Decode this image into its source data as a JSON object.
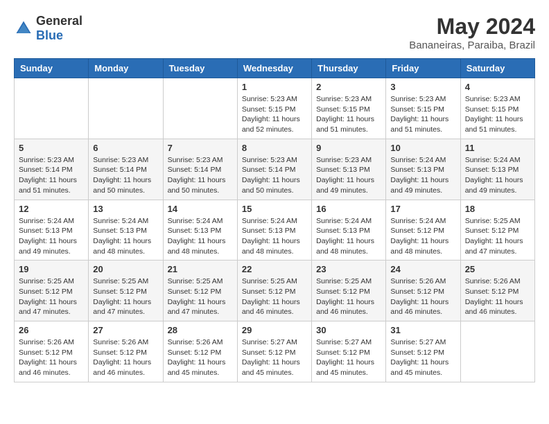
{
  "logo": {
    "general": "General",
    "blue": "Blue"
  },
  "title": {
    "month_year": "May 2024",
    "location": "Bananeiras, Paraiba, Brazil"
  },
  "weekdays": [
    "Sunday",
    "Monday",
    "Tuesday",
    "Wednesday",
    "Thursday",
    "Friday",
    "Saturday"
  ],
  "weeks": [
    [
      {
        "day": "",
        "info": ""
      },
      {
        "day": "",
        "info": ""
      },
      {
        "day": "",
        "info": ""
      },
      {
        "day": "1",
        "info": "Sunrise: 5:23 AM\nSunset: 5:15 PM\nDaylight: 11 hours\nand 52 minutes."
      },
      {
        "day": "2",
        "info": "Sunrise: 5:23 AM\nSunset: 5:15 PM\nDaylight: 11 hours\nand 51 minutes."
      },
      {
        "day": "3",
        "info": "Sunrise: 5:23 AM\nSunset: 5:15 PM\nDaylight: 11 hours\nand 51 minutes."
      },
      {
        "day": "4",
        "info": "Sunrise: 5:23 AM\nSunset: 5:15 PM\nDaylight: 11 hours\nand 51 minutes."
      }
    ],
    [
      {
        "day": "5",
        "info": "Sunrise: 5:23 AM\nSunset: 5:14 PM\nDaylight: 11 hours\nand 51 minutes."
      },
      {
        "day": "6",
        "info": "Sunrise: 5:23 AM\nSunset: 5:14 PM\nDaylight: 11 hours\nand 50 minutes."
      },
      {
        "day": "7",
        "info": "Sunrise: 5:23 AM\nSunset: 5:14 PM\nDaylight: 11 hours\nand 50 minutes."
      },
      {
        "day": "8",
        "info": "Sunrise: 5:23 AM\nSunset: 5:14 PM\nDaylight: 11 hours\nand 50 minutes."
      },
      {
        "day": "9",
        "info": "Sunrise: 5:23 AM\nSunset: 5:13 PM\nDaylight: 11 hours\nand 49 minutes."
      },
      {
        "day": "10",
        "info": "Sunrise: 5:24 AM\nSunset: 5:13 PM\nDaylight: 11 hours\nand 49 minutes."
      },
      {
        "day": "11",
        "info": "Sunrise: 5:24 AM\nSunset: 5:13 PM\nDaylight: 11 hours\nand 49 minutes."
      }
    ],
    [
      {
        "day": "12",
        "info": "Sunrise: 5:24 AM\nSunset: 5:13 PM\nDaylight: 11 hours\nand 49 minutes."
      },
      {
        "day": "13",
        "info": "Sunrise: 5:24 AM\nSunset: 5:13 PM\nDaylight: 11 hours\nand 48 minutes."
      },
      {
        "day": "14",
        "info": "Sunrise: 5:24 AM\nSunset: 5:13 PM\nDaylight: 11 hours\nand 48 minutes."
      },
      {
        "day": "15",
        "info": "Sunrise: 5:24 AM\nSunset: 5:13 PM\nDaylight: 11 hours\nand 48 minutes."
      },
      {
        "day": "16",
        "info": "Sunrise: 5:24 AM\nSunset: 5:13 PM\nDaylight: 11 hours\nand 48 minutes."
      },
      {
        "day": "17",
        "info": "Sunrise: 5:24 AM\nSunset: 5:12 PM\nDaylight: 11 hours\nand 48 minutes."
      },
      {
        "day": "18",
        "info": "Sunrise: 5:25 AM\nSunset: 5:12 PM\nDaylight: 11 hours\nand 47 minutes."
      }
    ],
    [
      {
        "day": "19",
        "info": "Sunrise: 5:25 AM\nSunset: 5:12 PM\nDaylight: 11 hours\nand 47 minutes."
      },
      {
        "day": "20",
        "info": "Sunrise: 5:25 AM\nSunset: 5:12 PM\nDaylight: 11 hours\nand 47 minutes."
      },
      {
        "day": "21",
        "info": "Sunrise: 5:25 AM\nSunset: 5:12 PM\nDaylight: 11 hours\nand 47 minutes."
      },
      {
        "day": "22",
        "info": "Sunrise: 5:25 AM\nSunset: 5:12 PM\nDaylight: 11 hours\nand 46 minutes."
      },
      {
        "day": "23",
        "info": "Sunrise: 5:25 AM\nSunset: 5:12 PM\nDaylight: 11 hours\nand 46 minutes."
      },
      {
        "day": "24",
        "info": "Sunrise: 5:26 AM\nSunset: 5:12 PM\nDaylight: 11 hours\nand 46 minutes."
      },
      {
        "day": "25",
        "info": "Sunrise: 5:26 AM\nSunset: 5:12 PM\nDaylight: 11 hours\nand 46 minutes."
      }
    ],
    [
      {
        "day": "26",
        "info": "Sunrise: 5:26 AM\nSunset: 5:12 PM\nDaylight: 11 hours\nand 46 minutes."
      },
      {
        "day": "27",
        "info": "Sunrise: 5:26 AM\nSunset: 5:12 PM\nDaylight: 11 hours\nand 46 minutes."
      },
      {
        "day": "28",
        "info": "Sunrise: 5:26 AM\nSunset: 5:12 PM\nDaylight: 11 hours\nand 45 minutes."
      },
      {
        "day": "29",
        "info": "Sunrise: 5:27 AM\nSunset: 5:12 PM\nDaylight: 11 hours\nand 45 minutes."
      },
      {
        "day": "30",
        "info": "Sunrise: 5:27 AM\nSunset: 5:12 PM\nDaylight: 11 hours\nand 45 minutes."
      },
      {
        "day": "31",
        "info": "Sunrise: 5:27 AM\nSunset: 5:12 PM\nDaylight: 11 hours\nand 45 minutes."
      },
      {
        "day": "",
        "info": ""
      }
    ]
  ]
}
